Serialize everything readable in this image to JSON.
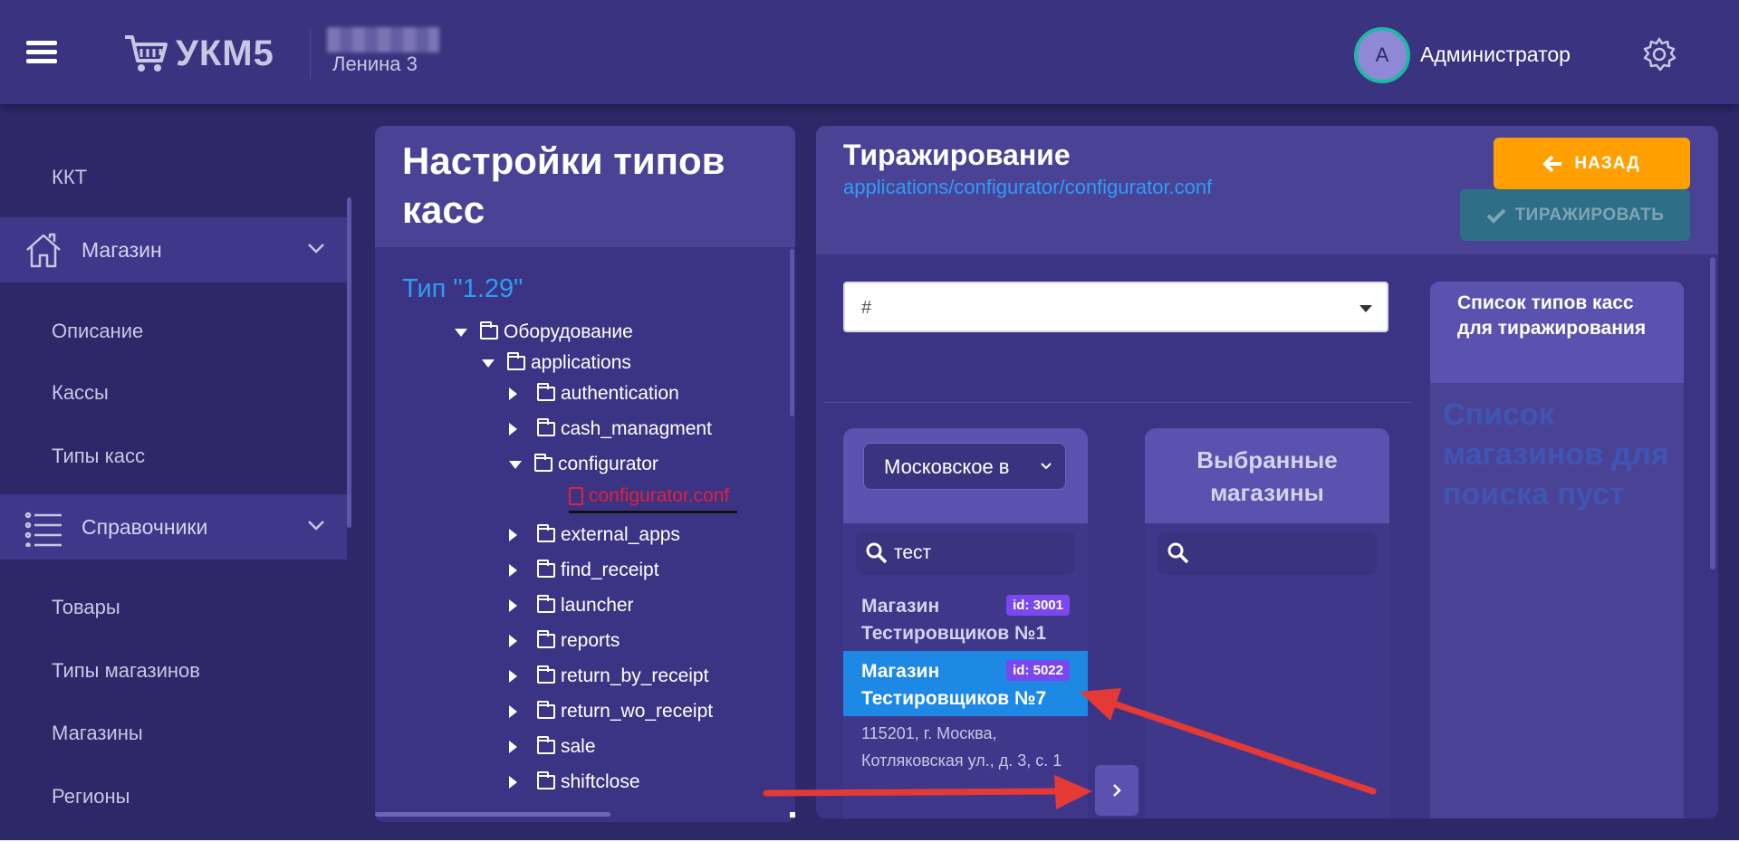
{
  "header": {
    "logo_text": "УКМ5",
    "store_name": "Ленина 3",
    "avatar_letter": "А",
    "user_name": "Администратор"
  },
  "sidebar": {
    "items": [
      {
        "label": "ККТ"
      },
      {
        "label": "Магазин",
        "group": true,
        "icon": "home-icon"
      },
      {
        "label": "Описание"
      },
      {
        "label": "Кассы"
      },
      {
        "label": "Типы касс"
      },
      {
        "label": "Справочники",
        "group": true,
        "icon": "list-icon"
      },
      {
        "label": "Товары"
      },
      {
        "label": "Типы магазинов"
      },
      {
        "label": "Магазины"
      },
      {
        "label": "Регионы"
      }
    ]
  },
  "settings_panel": {
    "title": "Настройки типов касс",
    "type_label": "Тип \"1.29\"",
    "tree": [
      {
        "label": "Оборудование",
        "state": "expanded"
      },
      {
        "label": "applications",
        "state": "expanded"
      },
      {
        "label": "authentication",
        "state": "collapsed"
      },
      {
        "label": "cash_managment",
        "state": "collapsed"
      },
      {
        "label": "configurator",
        "state": "expanded"
      },
      {
        "label": "configurator.conf",
        "state": "file"
      },
      {
        "label": "external_apps",
        "state": "collapsed"
      },
      {
        "label": "find_receipt",
        "state": "collapsed"
      },
      {
        "label": "launcher",
        "state": "collapsed"
      },
      {
        "label": "reports",
        "state": "collapsed"
      },
      {
        "label": "return_by_receipt",
        "state": "collapsed"
      },
      {
        "label": "return_wo_receipt",
        "state": "collapsed"
      },
      {
        "label": "sale",
        "state": "collapsed"
      },
      {
        "label": "shiftclose",
        "state": "collapsed"
      }
    ]
  },
  "replication": {
    "title": "Тиражирование",
    "path": "applications/configurator/configurator.conf",
    "back_label": "НАЗАД",
    "replicate_label": "ТИРАЖИРОВАТЬ",
    "select_value": "#",
    "region_select": "Московское в",
    "search_value": "тест",
    "stores": [
      {
        "name": "Магазин Тестировщиков №1",
        "id": "id: 3001",
        "active": false
      },
      {
        "name": "Магазин Тестировщиков №7",
        "id": "id: 5022",
        "active": true
      }
    ],
    "store_address": "115201, г. Москва, Котляковская ул., д. 3, с. 1",
    "selected_title": "Выбранные магазины",
    "types_list_title": "Список типов касс для тиражирования",
    "empty_search_text": "Список магазинов для поиска пуст"
  },
  "colors": {
    "background": "#2e2869",
    "header": "#3a3380",
    "accent_blue": "#2f9cf4",
    "back_button": "#ffa000",
    "replicate_button": "#2e6e86",
    "id_badge": "#7a48ee",
    "selected_row": "#1e88e5",
    "file_red": "#e0203b",
    "annotation_arrow": "#e53935"
  }
}
